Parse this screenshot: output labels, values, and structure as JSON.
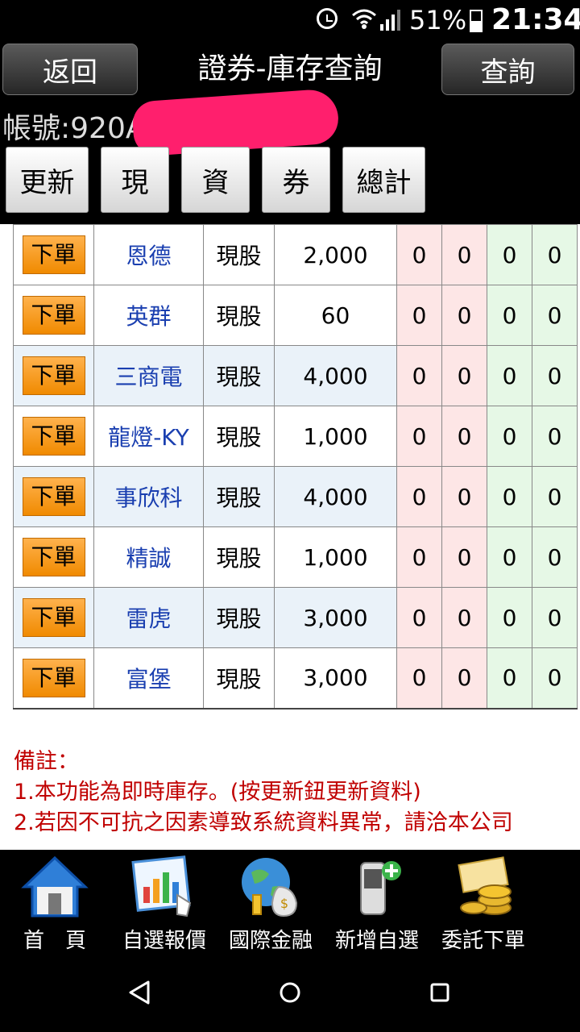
{
  "status_bar": {
    "battery_pct": "51%",
    "time": "21:34"
  },
  "header": {
    "back_label": "返回",
    "title": "證券-庫存查詢",
    "query_label": "查詢",
    "account_label": "帳號:",
    "account_value": "920A-2"
  },
  "tabs": [
    "更新",
    "現",
    "資",
    "券",
    "總計"
  ],
  "table": {
    "order_label": "下單",
    "rows": [
      {
        "name": "恩德",
        "type": "現股",
        "qty": "2,000",
        "c1": "0",
        "c2": "0",
        "c3": "0",
        "c4": "0"
      },
      {
        "name": "英群",
        "type": "現股",
        "qty": "60",
        "c1": "0",
        "c2": "0",
        "c3": "0",
        "c4": "0"
      },
      {
        "name": "三商電",
        "type": "現股",
        "qty": "4,000",
        "c1": "0",
        "c2": "0",
        "c3": "0",
        "c4": "0"
      },
      {
        "name": "龍燈-KY",
        "type": "現股",
        "qty": "1,000",
        "c1": "0",
        "c2": "0",
        "c3": "0",
        "c4": "0"
      },
      {
        "name": "事欣科",
        "type": "現股",
        "qty": "4,000",
        "c1": "0",
        "c2": "0",
        "c3": "0",
        "c4": "0"
      },
      {
        "name": "精誠",
        "type": "現股",
        "qty": "1,000",
        "c1": "0",
        "c2": "0",
        "c3": "0",
        "c4": "0"
      },
      {
        "name": "雷虎",
        "type": "現股",
        "qty": "3,000",
        "c1": "0",
        "c2": "0",
        "c3": "0",
        "c4": "0"
      },
      {
        "name": "富堡",
        "type": "現股",
        "qty": "3,000",
        "c1": "0",
        "c2": "0",
        "c3": "0",
        "c4": "0"
      }
    ]
  },
  "notes": {
    "title": "備註：",
    "line1": "1.本功能為即時庫存。(按更新鈕更新資料)",
    "line2": "2.若因不可抗之因素導致系統資料異常，請洽本公司"
  },
  "bottom_nav": [
    {
      "label": "首　頁",
      "icon": "home-icon"
    },
    {
      "label": "自選報價",
      "icon": "chart-icon"
    },
    {
      "label": "國際金融",
      "icon": "globe-money-icon"
    },
    {
      "label": "新增自選",
      "icon": "phone-add-icon"
    },
    {
      "label": "委託下單",
      "icon": "coins-icon"
    }
  ],
  "colors": {
    "order_button": "#f08a00",
    "stock_name": "#1a3fb0",
    "note_text": "#c00000",
    "redaction": "#ff1f6d"
  }
}
